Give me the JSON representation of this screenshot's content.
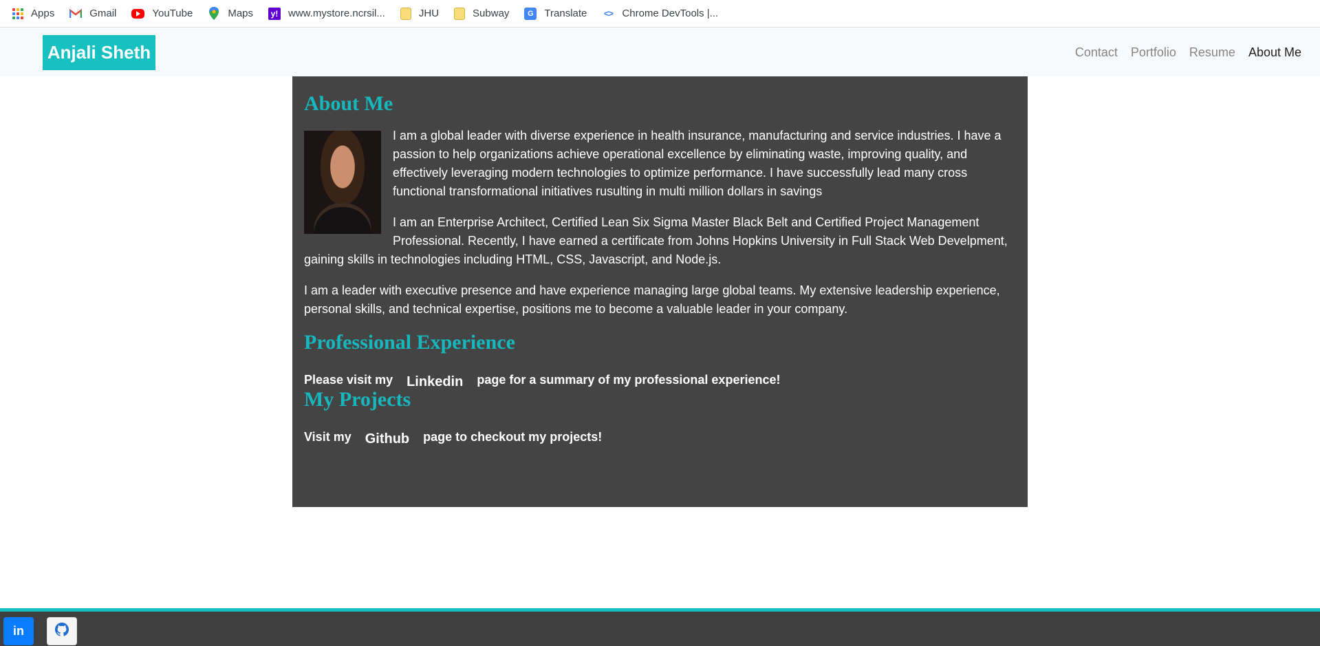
{
  "bookmarks": [
    {
      "label": "Apps",
      "icon": "apps-icon"
    },
    {
      "label": "Gmail",
      "icon": "gmail-icon"
    },
    {
      "label": "YouTube",
      "icon": "youtube-icon"
    },
    {
      "label": "Maps",
      "icon": "maps-icon"
    },
    {
      "label": "www.mystore.ncrsil...",
      "icon": "yahoo-icon"
    },
    {
      "label": "JHU",
      "icon": "folder-icon"
    },
    {
      "label": "Subway",
      "icon": "folder-icon"
    },
    {
      "label": "Translate",
      "icon": "translate-icon"
    },
    {
      "label": "Chrome DevTools |...",
      "icon": "devtools-icon"
    }
  ],
  "nav": {
    "brand": "Anjali Sheth",
    "links": [
      "Contact",
      "Portfolio",
      "Resume",
      "About Me"
    ],
    "active": "About Me"
  },
  "about": {
    "heading": "About Me",
    "paragraphs": [
      "I am a global leader with diverse experience in health insurance, manufacturing and service industries. I have a passion to help organizations achieve operational excellence by eliminating waste, improving quality, and effectively leveraging modern technologies to optimize performance. I have successfully lead many cross functional transformational initiatives rusulting in multi million dollars in savings",
      "I am an Enterprise Architect, Certified Lean Six Sigma Master Black Belt and Certified Project Management Professional. Recently, I have earned a certificate from Johns Hopkins University in Full Stack Web Develpment, gaining skills in technologies including HTML, CSS, Javascript, and Node.js.",
      "I am a leader with executive presence and have experience managing large global teams. My extensive leadership experience, personal skills, and technical expertise, positions me to become a valuable leader in your company."
    ]
  },
  "experience": {
    "heading": "Professional Experience",
    "prefix": "Please visit my",
    "link": "Linkedin",
    "suffix": "page for a summary of my professional experience!"
  },
  "projects": {
    "heading": "My Projects",
    "prefix": "Visit my",
    "link": "Github",
    "suffix": "page to checkout my projects!"
  },
  "footer": {
    "linkedin_label": "in"
  },
  "colors": {
    "accent": "#17c1c1",
    "heading": "#17b8bd",
    "card_bg": "#444444",
    "footer_bg": "#3f3f3f",
    "linkedin_blue": "#0a7cff"
  }
}
